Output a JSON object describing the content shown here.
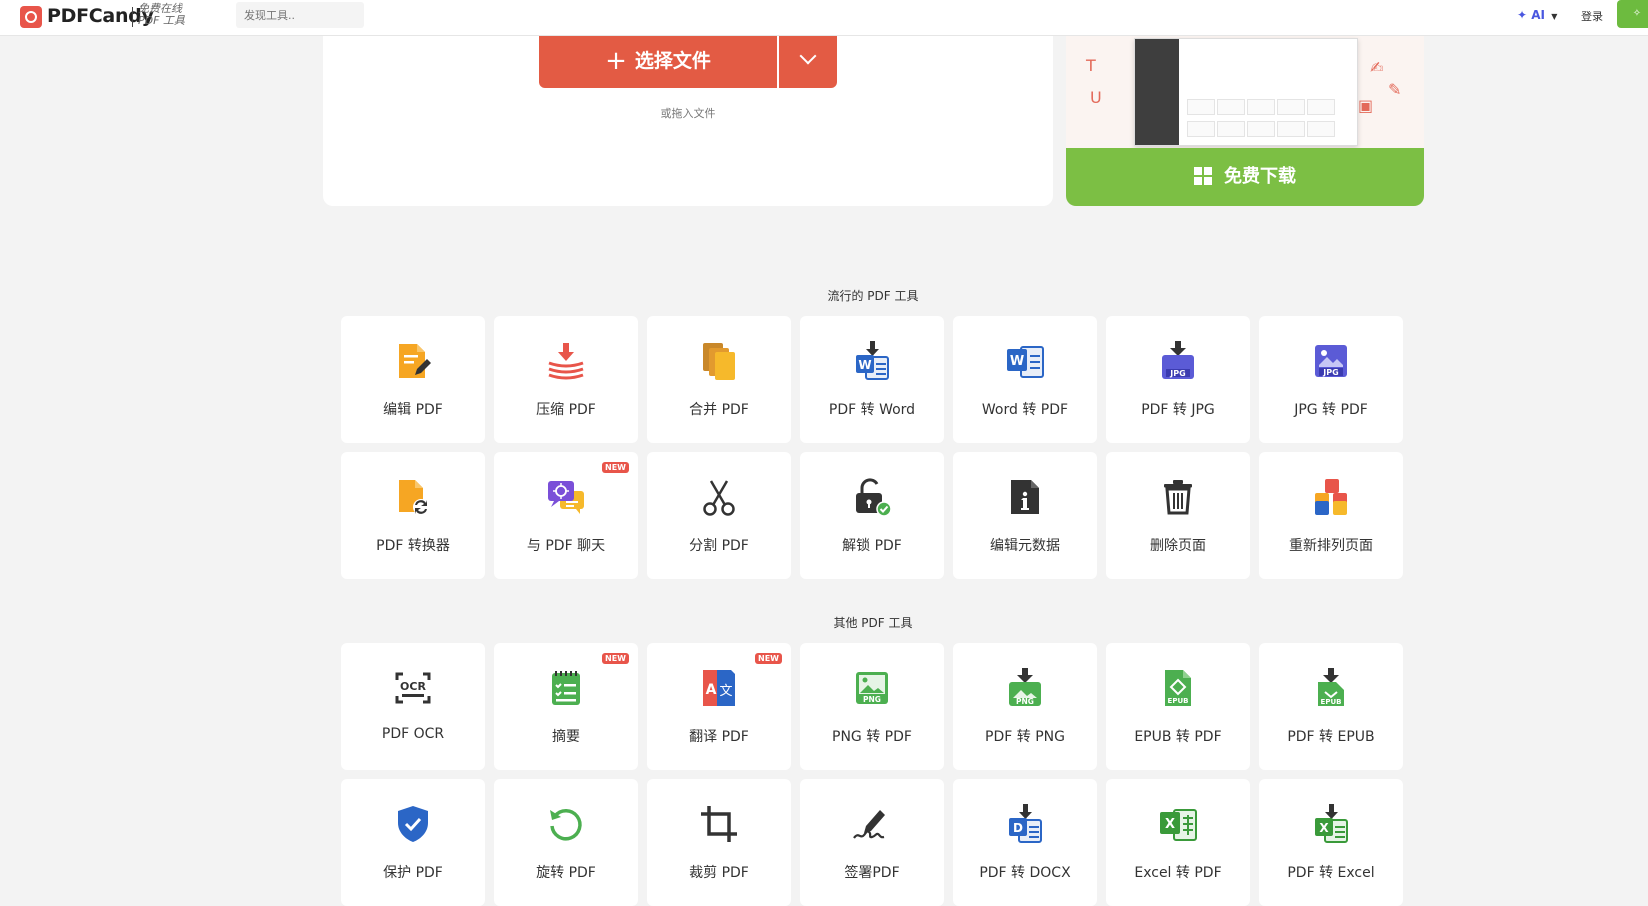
{
  "header": {
    "brand": "PDFCandy",
    "tagline": "免费在线 PDF 工具",
    "search_placeholder": "发现工具..",
    "ai_label": "AI",
    "login_label": "登录"
  },
  "upload": {
    "choose_label": "选择文件",
    "drop_hint": "或拖入文件"
  },
  "promo": {
    "download_label": "免费下载"
  },
  "sections": {
    "popular_title": "流行的 PDF 工具",
    "other_title": "其他 PDF 工具"
  },
  "popular_tools": [
    {
      "label": "编辑 PDF",
      "icon": "edit-pdf-icon"
    },
    {
      "label": "压缩 PDF",
      "icon": "compress-pdf-icon"
    },
    {
      "label": "合并 PDF",
      "icon": "merge-pdf-icon"
    },
    {
      "label": "PDF 转 Word",
      "icon": "pdf-to-word-icon"
    },
    {
      "label": "Word 转 PDF",
      "icon": "word-to-pdf-icon"
    },
    {
      "label": "PDF 转 JPG",
      "icon": "pdf-to-jpg-icon"
    },
    {
      "label": "JPG 转 PDF",
      "icon": "jpg-to-pdf-icon"
    },
    {
      "label": "PDF 转换器",
      "icon": "pdf-converter-icon"
    },
    {
      "label": "与 PDF 聊天",
      "icon": "chat-pdf-icon",
      "badge": "NEW"
    },
    {
      "label": "分割 PDF",
      "icon": "scissors-icon"
    },
    {
      "label": "解锁 PDF",
      "icon": "unlock-icon"
    },
    {
      "label": "编辑元数据",
      "icon": "metadata-icon"
    },
    {
      "label": "删除页面",
      "icon": "trash-icon"
    },
    {
      "label": "重新排列页面",
      "icon": "rearrange-icon"
    }
  ],
  "other_tools": [
    {
      "label": "PDF OCR",
      "icon": "ocr-icon"
    },
    {
      "label": "摘要",
      "icon": "summary-icon",
      "badge": "NEW"
    },
    {
      "label": "翻译 PDF",
      "icon": "translate-icon",
      "badge": "NEW"
    },
    {
      "label": "PNG 转 PDF",
      "icon": "png-to-pdf-icon"
    },
    {
      "label": "PDF 转 PNG",
      "icon": "pdf-to-png-icon"
    },
    {
      "label": "EPUB 转 PDF",
      "icon": "epub-to-pdf-icon"
    },
    {
      "label": "PDF 转 EPUB",
      "icon": "pdf-to-epub-icon"
    },
    {
      "label": "保护 PDF",
      "icon": "shield-icon"
    },
    {
      "label": "旋转 PDF",
      "icon": "rotate-icon"
    },
    {
      "label": "裁剪 PDF",
      "icon": "crop-icon"
    },
    {
      "label": "签署PDF",
      "icon": "sign-icon"
    },
    {
      "label": "PDF 转 DOCX",
      "icon": "pdf-to-docx-icon"
    },
    {
      "label": "Excel 转 PDF",
      "icon": "excel-to-pdf-icon"
    },
    {
      "label": "PDF 转 Excel",
      "icon": "pdf-to-excel-icon"
    }
  ]
}
